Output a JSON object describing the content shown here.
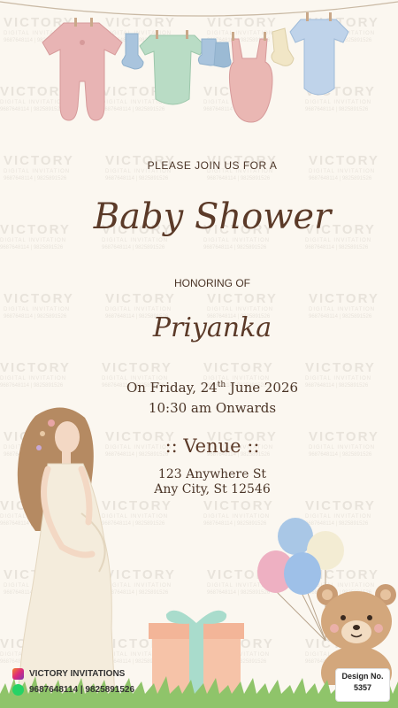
{
  "watermark": {
    "brand": "VICTORY",
    "subtitle": "DIGITAL INVITATION",
    "phones": "9687648114 | 9825891526"
  },
  "invite_line": "PLEASE JOIN US FOR A",
  "title": "Baby Shower",
  "honoring": "HONORING OF",
  "name": "Priyanka",
  "date": {
    "prefix": "On Friday, 24",
    "suffix": "th",
    "rest": " June 2026"
  },
  "time": "10:30 am Onwards",
  "venue_heading": ":: Venue ::",
  "address_line1": "123 Anywhere St",
  "address_line2": "Any City, St 12546",
  "footer": {
    "brand": "VICTORY INVITATIONS",
    "phones": "9687648114 | 9825891526",
    "design_label": "Design No.",
    "design_number": "5357"
  },
  "colors": {
    "background": "#fbf7f0",
    "text_brown": "#5b3a28",
    "instagram": "#d6336c",
    "whatsapp": "#25d366"
  },
  "icons": [
    "instagram-icon",
    "whatsapp-icon"
  ]
}
